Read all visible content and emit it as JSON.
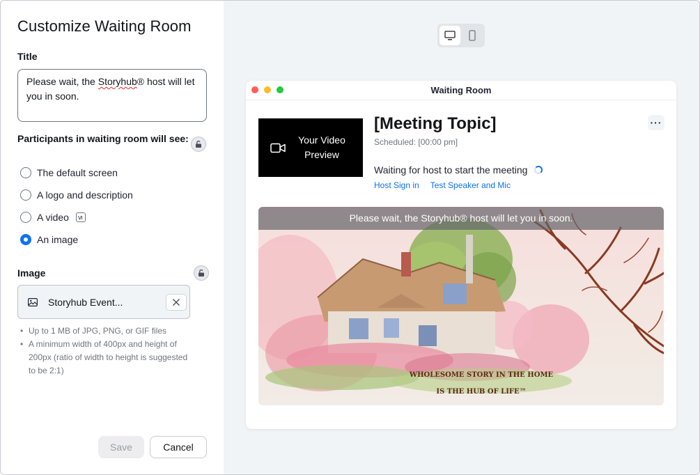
{
  "left": {
    "title": "Customize Waiting Room",
    "title_section_label": "Title",
    "title_text_before": "Please wait, the ",
    "title_text_misspelled": "Storyhub",
    "title_text_after": "® host will let you in soon.",
    "participants_label": "Participants in waiting room will see:",
    "options": [
      {
        "label": "The default screen",
        "checked": false
      },
      {
        "label": "A logo and description",
        "checked": false
      },
      {
        "label": "A video",
        "checked": false
      },
      {
        "label": "An image",
        "checked": true
      }
    ],
    "image_label": "Image",
    "file_name": "Storyhub Event...",
    "hints": [
      "Up to 1 MB of JPG, PNG, or GIF files",
      "A minimum width of 400px and height of 200px (ratio of width to height is suggested to be 2:1)"
    ],
    "save_label": "Save",
    "cancel_label": "Cancel"
  },
  "preview": {
    "window_title": "Waiting Room",
    "video_preview": "Your Video Preview",
    "meeting_topic": "[Meeting Topic]",
    "scheduled": "Scheduled: [00:00 pm]",
    "waiting_text": "Waiting for host to start the meeting",
    "host_sign_in": "Host Sign in",
    "test_speaker": "Test Speaker and Mic",
    "more_label": "···",
    "banner_text": "Please wait, the Storyhub® host will let you in soon.",
    "image_caption_line1": "WHOLESOME STORY IN THE HOME",
    "image_caption_line2": "IS THE HUB OF LIFE™"
  },
  "icons": {
    "desktop": "desktop-icon",
    "mobile": "mobile-icon",
    "lock": "lock-icon",
    "camera": "camera-icon",
    "image": "image-icon",
    "close": "close-icon"
  },
  "colors": {
    "accent": "#0e72ed",
    "mac_red": "#fe5f57",
    "mac_yellow": "#febc2e",
    "mac_green": "#28c840"
  }
}
